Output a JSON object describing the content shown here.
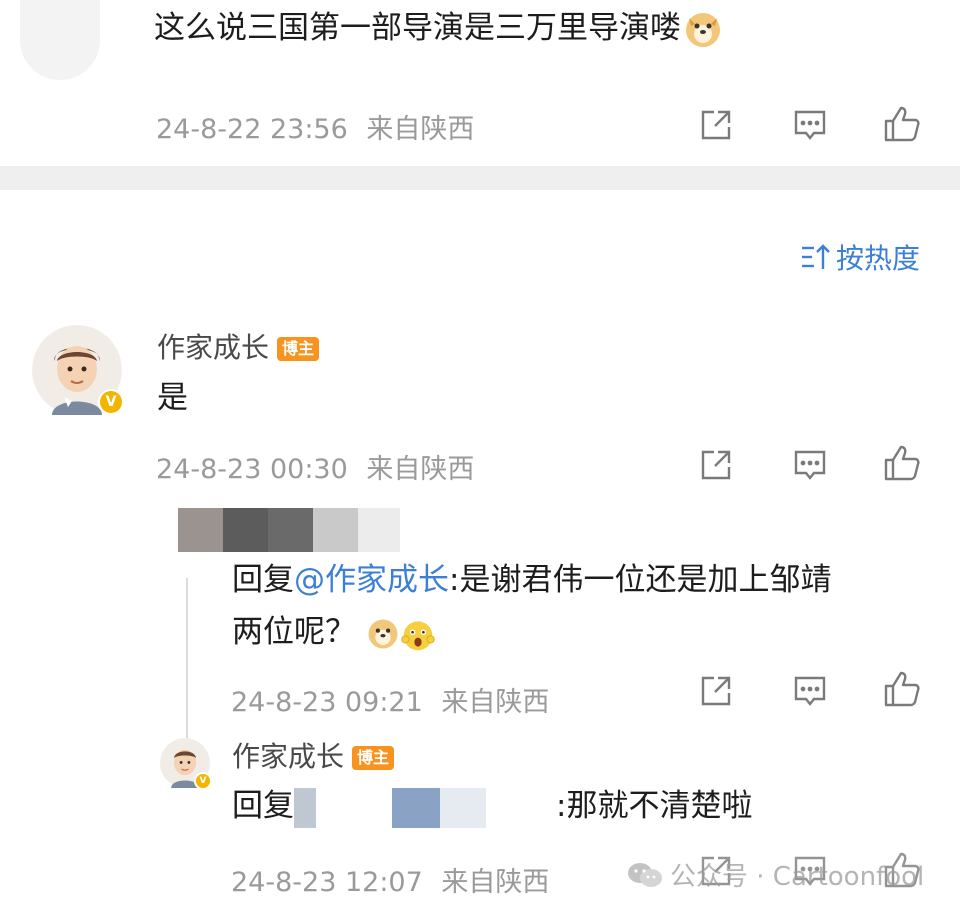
{
  "top_comment": {
    "text": "这么说三国第一部导演是三万里导演喽",
    "emoji": "doge-emoji",
    "time": "24-8-22 23:56",
    "location": "来自陕西"
  },
  "sort": {
    "label": "按热度",
    "icon": "sort-icon"
  },
  "main_reply": {
    "author": "作家成长",
    "badge": "博主",
    "text": "是",
    "time": "24-8-23 00:30",
    "location": "来自陕西"
  },
  "sub_reply_1": {
    "prefix": "回复",
    "mention": "@作家成长",
    "text_line1": ":是谢君伟一位还是加上邹靖",
    "text_line2": "两位呢？",
    "time": "24-8-23 09:21",
    "location": "来自陕西"
  },
  "sub_reply_2": {
    "author": "作家成长",
    "badge": "博主",
    "prefix": "回复",
    "text": ":那就不清楚啦",
    "time": "24-8-23 12:07",
    "location": "来自陕西"
  },
  "watermark": {
    "text": "公众号 · Cartoonfool"
  },
  "colors": {
    "accent": "#3b7fd6",
    "badge": "#f7931e",
    "verified": "#f5b400",
    "divider": "#efefef"
  }
}
